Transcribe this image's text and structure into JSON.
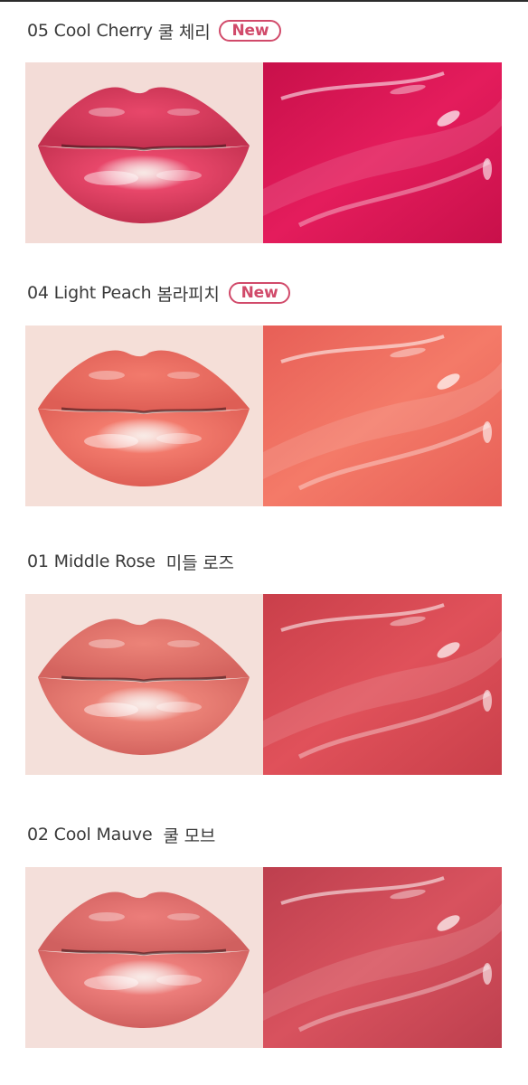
{
  "shades": [
    {
      "code": "05",
      "name": "Cool Cherry",
      "name_kr": "쿨 체리",
      "badge": "New",
      "lip_color": "#e8476a",
      "lip_dark": "#c2304f",
      "skin": "#f3dcd7",
      "swatch_base": "#e41c5c",
      "swatch_dark": "#c8104a",
      "icon": "lip-photo-icon"
    },
    {
      "code": "04",
      "name": "Light Peach",
      "name_kr": "봄라피치",
      "badge": "New",
      "lip_color": "#f27a6c",
      "lip_dark": "#de5e55",
      "skin": "#f5dfd8",
      "swatch_base": "#f47a68",
      "swatch_dark": "#e75f57",
      "icon": "lip-photo-icon"
    },
    {
      "code": "01",
      "name": "Middle Rose",
      "name_kr": "미들 로즈",
      "badge": "",
      "lip_color": "#ec8378",
      "lip_dark": "#d4645f",
      "skin": "#f4e0da",
      "swatch_base": "#e0515a",
      "swatch_dark": "#c93f4a",
      "icon": "lip-photo-icon"
    },
    {
      "code": "02",
      "name": "Cool Mauve",
      "name_kr": "쿨 모브",
      "badge": "",
      "lip_color": "#ec7d7a",
      "lip_dark": "#d0605f",
      "skin": "#f4dfda",
      "swatch_base": "#d8525e",
      "swatch_dark": "#bd3f4e",
      "icon": "lip-photo-icon"
    }
  ]
}
